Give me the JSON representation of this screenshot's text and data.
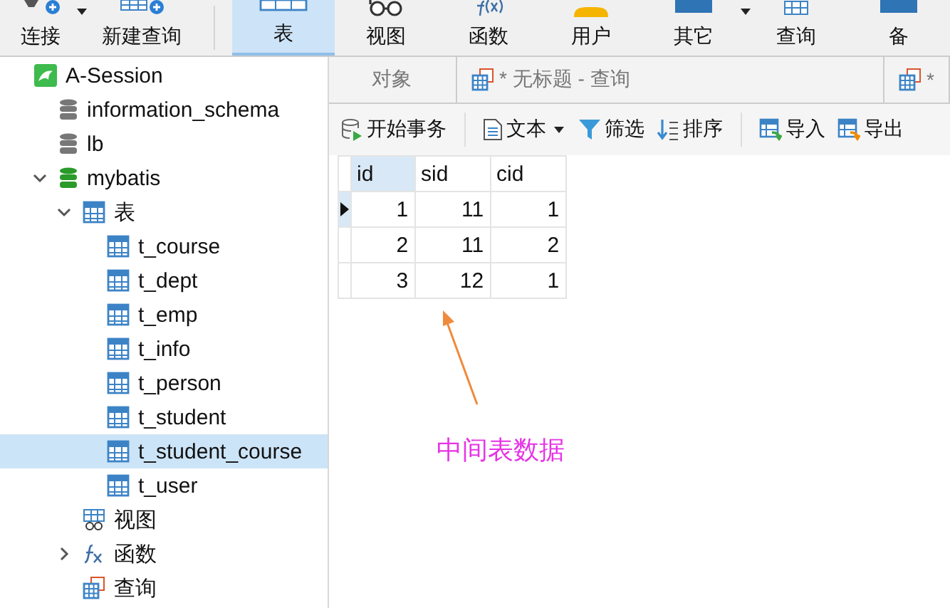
{
  "toolbar": {
    "items": [
      {
        "label": "连接",
        "caret": true,
        "selected": false
      },
      {
        "label": "新建查询",
        "caret": false,
        "selected": false
      },
      {
        "label": "表",
        "caret": false,
        "selected": true
      },
      {
        "label": "视图",
        "caret": false,
        "selected": false
      },
      {
        "label": "函数",
        "caret": false,
        "selected": false
      },
      {
        "label": "用户",
        "caret": false,
        "selected": false
      },
      {
        "label": "其它",
        "caret": true,
        "selected": false
      },
      {
        "label": "查询",
        "caret": false,
        "selected": false
      },
      {
        "label": "备",
        "caret": false,
        "selected": false
      }
    ]
  },
  "sidebar": {
    "tree": [
      {
        "label": "A-Session",
        "kind": "connection",
        "selected": false,
        "children": [
          {
            "label": "information_schema",
            "kind": "database",
            "selected": false
          },
          {
            "label": "lb",
            "kind": "database",
            "selected": false
          },
          {
            "label": "mybatis",
            "kind": "database",
            "expanded": true,
            "selected": false,
            "children": [
              {
                "label": "表",
                "kind": "table",
                "expanded": true,
                "selected": false,
                "children": [
                  {
                    "label": "t_course",
                    "kind": "table",
                    "selected": false
                  },
                  {
                    "label": "t_dept",
                    "kind": "table",
                    "selected": false
                  },
                  {
                    "label": "t_emp",
                    "kind": "table",
                    "selected": false
                  },
                  {
                    "label": "t_info",
                    "kind": "table",
                    "selected": false
                  },
                  {
                    "label": "t_person",
                    "kind": "table",
                    "selected": false
                  },
                  {
                    "label": "t_student",
                    "kind": "table",
                    "selected": false
                  },
                  {
                    "label": "t_student_course",
                    "kind": "table",
                    "selected": true
                  },
                  {
                    "label": "t_user",
                    "kind": "table",
                    "selected": false
                  }
                ]
              },
              {
                "label": "视图",
                "kind": "view",
                "selected": false
              },
              {
                "label": "函数",
                "kind": "function",
                "expanded": false,
                "selected": false
              },
              {
                "label": "查询",
                "kind": "query",
                "selected": false
              }
            ]
          }
        ]
      }
    ]
  },
  "tabs": [
    {
      "label": "对象",
      "icon": false,
      "selected": false
    },
    {
      "label": "* 无标题 - 查询",
      "icon": true,
      "selected": false
    },
    {
      "label": "*",
      "icon": true,
      "selected": false
    }
  ],
  "grid_toolbar": [
    {
      "label": "开始事务",
      "caret": false
    },
    {
      "label": "文本",
      "caret": true
    },
    {
      "label": "筛选",
      "caret": false
    },
    {
      "label": "排序",
      "caret": false
    },
    {
      "label": "导入",
      "caret": false
    },
    {
      "label": "导出",
      "caret": false
    }
  ],
  "table": {
    "columns": [
      {
        "label": "id",
        "selected": true
      },
      {
        "label": "sid",
        "selected": false
      },
      {
        "label": "cid",
        "selected": false
      }
    ],
    "rows": [
      {
        "current": true,
        "cells": [
          "1",
          "11",
          "1"
        ]
      },
      {
        "current": false,
        "cells": [
          "2",
          "11",
          "2"
        ]
      },
      {
        "current": false,
        "cells": [
          "3",
          "12",
          "1"
        ]
      }
    ]
  },
  "annotation": {
    "label": "中间表数据"
  }
}
